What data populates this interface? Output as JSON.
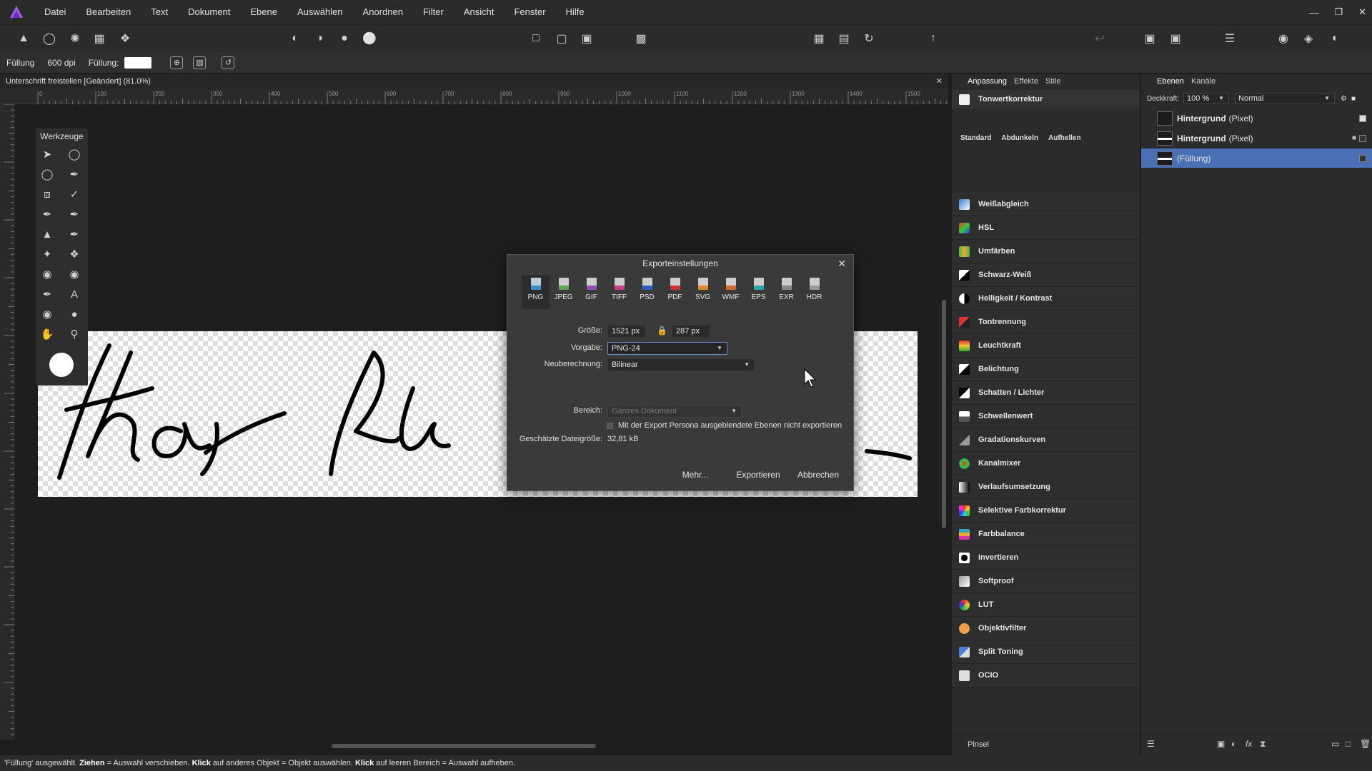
{
  "menu": [
    "Datei",
    "Bearbeiten",
    "Text",
    "Dokument",
    "Ebene",
    "Auswählen",
    "Anordnen",
    "Filter",
    "Ansicht",
    "Fenster",
    "Hilfe"
  ],
  "context": {
    "fill_label": "Füllung",
    "dpi": "600 dpi",
    "fill_label2": "Füllung:"
  },
  "document_tab": {
    "title": "Unterschrift freistellen [Geändert] (81.0%)"
  },
  "ruler": {
    "marks": [
      "0",
      "100",
      "200",
      "300",
      "400",
      "500",
      "600",
      "700",
      "800",
      "900",
      "1000",
      "1100",
      "1200",
      "1300",
      "1400",
      "1500"
    ],
    "unit": "px"
  },
  "tools": {
    "title": "Werkzeuge"
  },
  "export_dialog": {
    "title": "Exporteinstellungen",
    "formats": [
      "PNG",
      "JPEG",
      "GIF",
      "TIFF",
      "PSD",
      "PDF",
      "SVG",
      "WMF",
      "EPS",
      "EXR",
      "HDR"
    ],
    "selected_format": "PNG",
    "size_label": "Größe:",
    "width": "1521 px",
    "height": "287 px",
    "preset_label": "Vorgabe:",
    "preset": "PNG-24",
    "resample_label": "Neuberechnung:",
    "resample": "Bilinear",
    "area_label": "Bereich:",
    "area": "Ganzes Dokument",
    "checkbox_label": "Mit der Export Persona ausgeblendete Ebenen nicht exportieren",
    "filesize_label": "Geschätzte Dateigröße:",
    "filesize": "32,81 kB",
    "btn_more": "Mehr...",
    "btn_export": "Exportieren",
    "btn_cancel": "Abbrechen"
  },
  "adjust_panel": {
    "tabs": [
      "Anpassung",
      "Effekte",
      "Stile"
    ],
    "top_item": "Tonwertkorrektur",
    "presets": [
      "Standard",
      "Abdunkeln",
      "Aufhellen"
    ],
    "items": [
      "Weißabgleich",
      "HSL",
      "Umfärben",
      "Schwarz-Weiß",
      "Helligkeit / Kontrast",
      "Tontrennung",
      "Leuchtkraft",
      "Belichtung",
      "Schatten / Lichter",
      "Schwellenwert",
      "Gradationskurven",
      "Kanalmixer",
      "Verlaufsumsetzung",
      "Selektive Farbkorrektur",
      "Farbbalance",
      "Invertieren",
      "Softproof",
      "LUT",
      "Objektivfilter",
      "Split Toning",
      "OCIO"
    ],
    "bottom_tab": "Pinsel"
  },
  "layers_panel": {
    "tabs": [
      "Ebenen",
      "Kanäle"
    ],
    "opacity_label": "Deckkraft:",
    "opacity": "100 %",
    "blend_mode": "Normal",
    "layers": [
      {
        "name": "Hintergrund",
        "type": "(Pixel)"
      },
      {
        "name": "Hintergrund",
        "type": "(Pixel)"
      },
      {
        "name": "",
        "type": "(Füllung)"
      }
    ]
  },
  "status": {
    "s1": "'Füllung' ausgewählt. ",
    "b1": "Ziehen",
    "s2": " = Auswahl verschieben. ",
    "b2": "Klick",
    "s3": " auf anderes Objekt = Objekt auswählen. ",
    "b3": "Klick",
    "s4": " auf leeren Bereich = Auswahl aufheben."
  },
  "colors": {
    "accent": "#4a6fb4",
    "panel": "#2b2b2b",
    "canvas": "#1e1e1e"
  }
}
